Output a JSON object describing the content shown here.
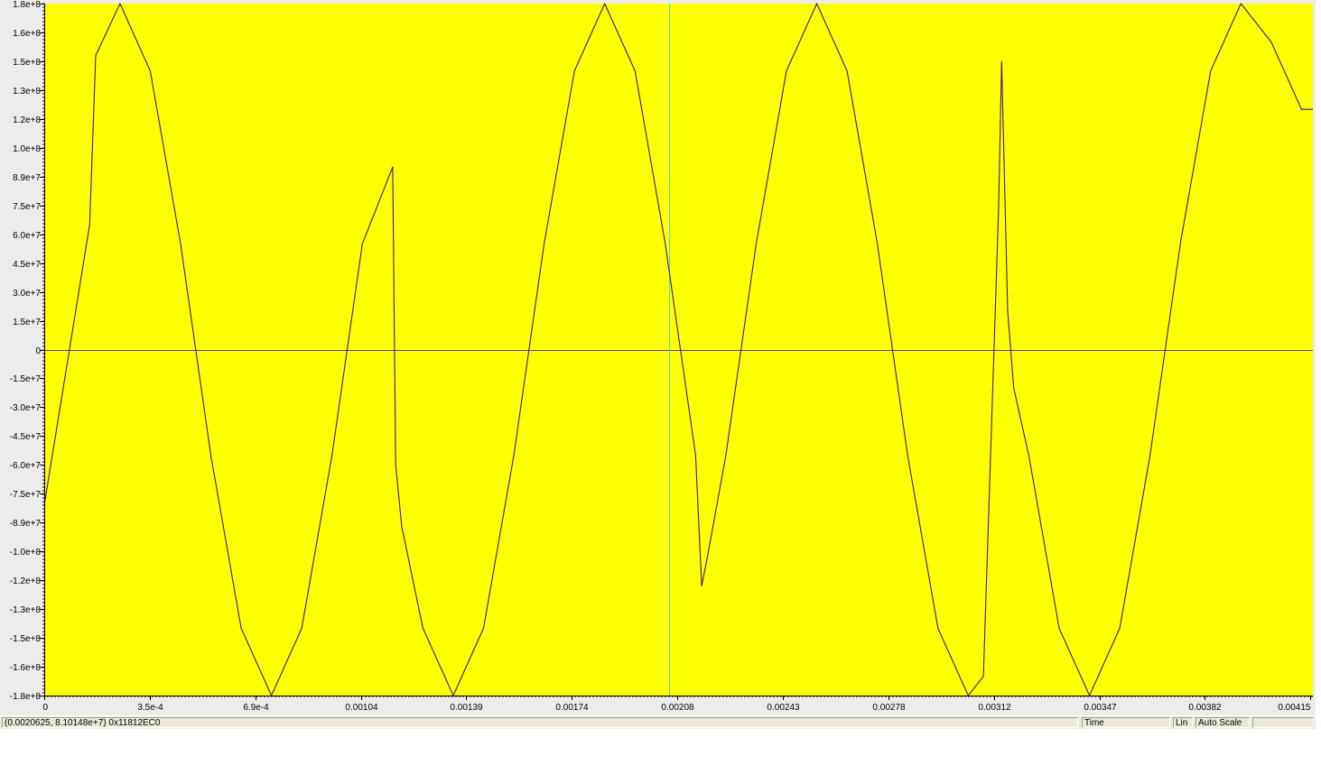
{
  "colors": {
    "plot_background": "#ffff00",
    "trace": "#3b1a8f",
    "zero_line": "#5b3fa0",
    "cursor_line": "#49d6e6",
    "axis": "#000000"
  },
  "status": {
    "coords": "(0.0020625, 8.10148e+7) 0x11812EC0",
    "xaxis": "Time",
    "scale": "Lin",
    "auto": "Auto Scale",
    "extra": ""
  },
  "chart_data": {
    "type": "line",
    "title": "",
    "xlabel": "",
    "ylabel": "",
    "xlim": [
      0,
      0.0041875
    ],
    "ylim": [
      -180000000.0,
      180000000.0
    ],
    "grid": false,
    "cursor_x": 0.0020625,
    "y_ticks": [
      {
        "value": 180000000.0,
        "label": "1.8e+8"
      },
      {
        "value": 165000000.0,
        "label": "1.6e+8"
      },
      {
        "value": 150000000.0,
        "label": "1.5e+8"
      },
      {
        "value": 135000000.0,
        "label": "1.3e+8"
      },
      {
        "value": 120000000.0,
        "label": "1.2e+8"
      },
      {
        "value": 105000000.0,
        "label": "1.0e+8"
      },
      {
        "value": 90000000.0,
        "label": "8.9e+7"
      },
      {
        "value": 75000000.0,
        "label": "7.5e+7"
      },
      {
        "value": 60000000.0,
        "label": "6.0e+7"
      },
      {
        "value": 45000000.0,
        "label": "4.5e+7"
      },
      {
        "value": 30000000.0,
        "label": "3.0e+7"
      },
      {
        "value": 15000000.0,
        "label": "1.5e+7"
      },
      {
        "value": 0,
        "label": "0"
      },
      {
        "value": -15000000.0,
        "label": "-1.5e+7"
      },
      {
        "value": -30000000.0,
        "label": "-3.0e+7"
      },
      {
        "value": -45000000.0,
        "label": "-4.5e+7"
      },
      {
        "value": -60000000.0,
        "label": "-6.0e+7"
      },
      {
        "value": -75000000.0,
        "label": "-7.5e+7"
      },
      {
        "value": -90000000.0,
        "label": "-8.9e+7"
      },
      {
        "value": -105000000.0,
        "label": "-1.0e+8"
      },
      {
        "value": -120000000.0,
        "label": "-1.2e+8"
      },
      {
        "value": -135000000.0,
        "label": "-1.3e+8"
      },
      {
        "value": -150000000.0,
        "label": "-1.5e+8"
      },
      {
        "value": -165000000.0,
        "label": "-1.6e+8"
      },
      {
        "value": -180000000.0,
        "label": "-1.8e+8"
      }
    ],
    "x_ticks": [
      {
        "value": 0,
        "label": "0"
      },
      {
        "value": 0.000348,
        "label": "3.5e-4"
      },
      {
        "value": 0.000697,
        "label": "6.9e-4"
      },
      {
        "value": 0.001045,
        "label": "0.00104"
      },
      {
        "value": 0.001393,
        "label": "0.00139"
      },
      {
        "value": 0.001741,
        "label": "0.00174"
      },
      {
        "value": 0.00209,
        "label": "0.00208"
      },
      {
        "value": 0.002438,
        "label": "0.00243"
      },
      {
        "value": 0.002786,
        "label": "0.00278"
      },
      {
        "value": 0.003134,
        "label": "0.00312"
      },
      {
        "value": 0.003483,
        "label": "0.00347"
      },
      {
        "value": 0.003831,
        "label": "0.00382"
      },
      {
        "value": 0.004179,
        "label": "0.00415"
      }
    ],
    "series": [
      {
        "x": [
          0,
          0.00015,
          0.00017,
          0.00025,
          0.00035,
          0.00045,
          0.00055,
          0.00065,
          0.00075,
          0.00085,
          0.00095,
          0.00105,
          0.00115,
          0.00116,
          0.00118,
          0.00125,
          0.00135,
          0.00145,
          0.00155,
          0.00165,
          0.00175,
          0.00185,
          0.00195,
          0.00205,
          0.00215,
          0.00217,
          0.00219,
          0.00225,
          0.00235,
          0.00245,
          0.00255,
          0.00265,
          0.00275,
          0.00285,
          0.00295,
          0.00305,
          0.0031,
          0.00315,
          0.00316,
          0.00318,
          0.0032,
          0.00325,
          0.00335,
          0.00345,
          0.00355,
          0.00365,
          0.00375,
          0.00385,
          0.00395,
          0.00405,
          0.00415,
          0.0041875
        ],
        "y": [
          -81000000.0,
          65000000.0,
          153000000.0,
          180000000.0,
          145000000.0,
          55000000.0,
          -55000000.0,
          -145000000.0,
          -180000000.0,
          -145000000.0,
          -55000000.0,
          55000000.0,
          95000000.0,
          -60000000.0,
          -92000000.0,
          -145000000.0,
          -180000000.0,
          -145000000.0,
          -55000000.0,
          55000000.0,
          145000000.0,
          180000000.0,
          145000000.0,
          55000000.0,
          -55000000.0,
          -123000000.0,
          -107000000.0,
          -55000000.0,
          55000000.0,
          145000000.0,
          180000000.0,
          145000000.0,
          55000000.0,
          -55000000.0,
          -145000000.0,
          -180000000.0,
          -170000000.0,
          73000000.0,
          150000000.0,
          20000000.0,
          -20000000.0,
          -55000000.0,
          -145000000.0,
          -180000000.0,
          -145000000.0,
          -55000000.0,
          55000000.0,
          145000000.0,
          180000000.0,
          160000000.0,
          125000000.0,
          125000000.0
        ]
      }
    ]
  }
}
